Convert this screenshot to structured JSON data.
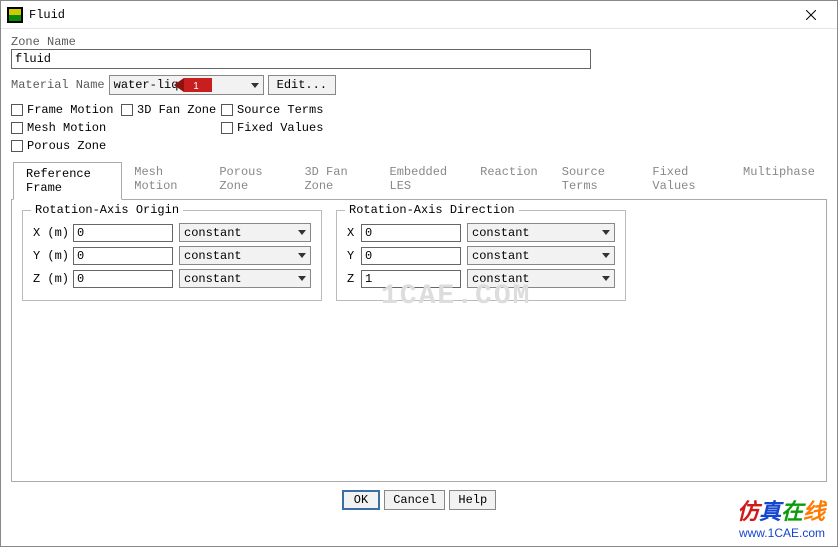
{
  "window": {
    "title": "Fluid"
  },
  "zone": {
    "label": "Zone Name",
    "value": "fluid"
  },
  "material": {
    "label": "Material Name",
    "selected": "water-liquid",
    "annotation_number": "1",
    "edit_btn": "Edit..."
  },
  "checkboxes": {
    "frame_motion": "Frame Motion",
    "fan_zone_3d": "3D Fan Zone",
    "source_terms": "Source Terms",
    "mesh_motion": "Mesh Motion",
    "fixed_values": "Fixed Values",
    "porous_zone": "Porous Zone"
  },
  "tabs": {
    "reference_frame": "Reference Frame",
    "mesh_motion": "Mesh Motion",
    "porous_zone": "Porous Zone",
    "fan_zone_3d": "3D Fan Zone",
    "embedded_les": "Embedded LES",
    "reaction": "Reaction",
    "source_terms": "Source Terms",
    "fixed_values": "Fixed Values",
    "multiphase": "Multiphase"
  },
  "ref_frame": {
    "origin": {
      "title": "Rotation-Axis Origin",
      "x_label": "X (m)",
      "y_label": "Y (m)",
      "z_label": "Z (m)",
      "x_val": "0",
      "y_val": "0",
      "z_val": "0",
      "x_mode": "constant",
      "y_mode": "constant",
      "z_mode": "constant"
    },
    "direction": {
      "title": "Rotation-Axis Direction",
      "x_label": "X",
      "y_label": "Y",
      "z_label": "Z",
      "x_val": "0",
      "y_val": "0",
      "z_val": "1",
      "x_mode": "constant",
      "y_mode": "constant",
      "z_mode": "constant"
    }
  },
  "buttons": {
    "ok": "OK",
    "cancel": "Cancel",
    "help": "Help"
  },
  "watermark": "1CAE.COM",
  "logo": {
    "cn": [
      "仿",
      "真",
      "在",
      "线"
    ],
    "url": "www.1CAE.com"
  }
}
